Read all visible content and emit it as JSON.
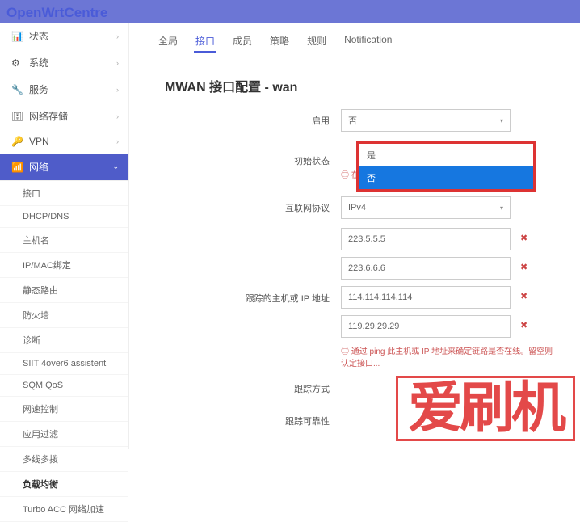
{
  "logo": "OpenWrtCentre",
  "sidebar": {
    "main": [
      {
        "icon": "📊",
        "label": "状态"
      },
      {
        "icon": "⚙",
        "label": "系统"
      },
      {
        "icon": "🔧",
        "label": "服务"
      },
      {
        "icon": "🗄",
        "label": "网络存储"
      },
      {
        "icon": "🔑",
        "label": "VPN"
      },
      {
        "icon": "📶",
        "label": "网络"
      }
    ],
    "sub": [
      {
        "label": "接口"
      },
      {
        "label": "DHCP/DNS"
      },
      {
        "label": "主机名"
      },
      {
        "label": "IP/MAC绑定"
      },
      {
        "label": "静态路由"
      },
      {
        "label": "防火墙"
      },
      {
        "label": "诊断"
      },
      {
        "label": "SIIT 4over6 assistent"
      },
      {
        "label": "SQM QoS"
      },
      {
        "label": "网速控制"
      },
      {
        "label": "应用过滤"
      },
      {
        "label": "多线多拨"
      },
      {
        "label": "负载均衡",
        "bold": true
      },
      {
        "label": "Turbo ACC 网络加速"
      }
    ]
  },
  "tabs": [
    {
      "label": "全局"
    },
    {
      "label": "接口",
      "active": true
    },
    {
      "label": "成员"
    },
    {
      "label": "策略"
    },
    {
      "label": "规则"
    },
    {
      "label": "Notification"
    }
  ],
  "title": "MWAN 接口配置 - wan",
  "form": {
    "enable": {
      "label": "启用",
      "value": "否"
    },
    "initstate": {
      "label": "初始状态",
      "hint": "◎ 在 up 事件发生时扩展此接口状态"
    },
    "dropdown": {
      "opts": [
        "是",
        "否"
      ],
      "selected": "否"
    },
    "proto": {
      "label": "互联网协议",
      "value": "IPv4"
    },
    "track": {
      "label": "跟踪的主机或 IP 地址",
      "values": [
        "223.5.5.5",
        "223.6.6.6",
        "114.114.114.114",
        "119.29.29.29"
      ],
      "hint": "◎ 通过 ping 此主机或 IP 地址来确定链路是否在线。留空则认定接口..."
    },
    "method": {
      "label": "跟踪方式"
    },
    "reliab": {
      "label": "跟踪可靠性"
    }
  },
  "watermark": "爱刷机"
}
